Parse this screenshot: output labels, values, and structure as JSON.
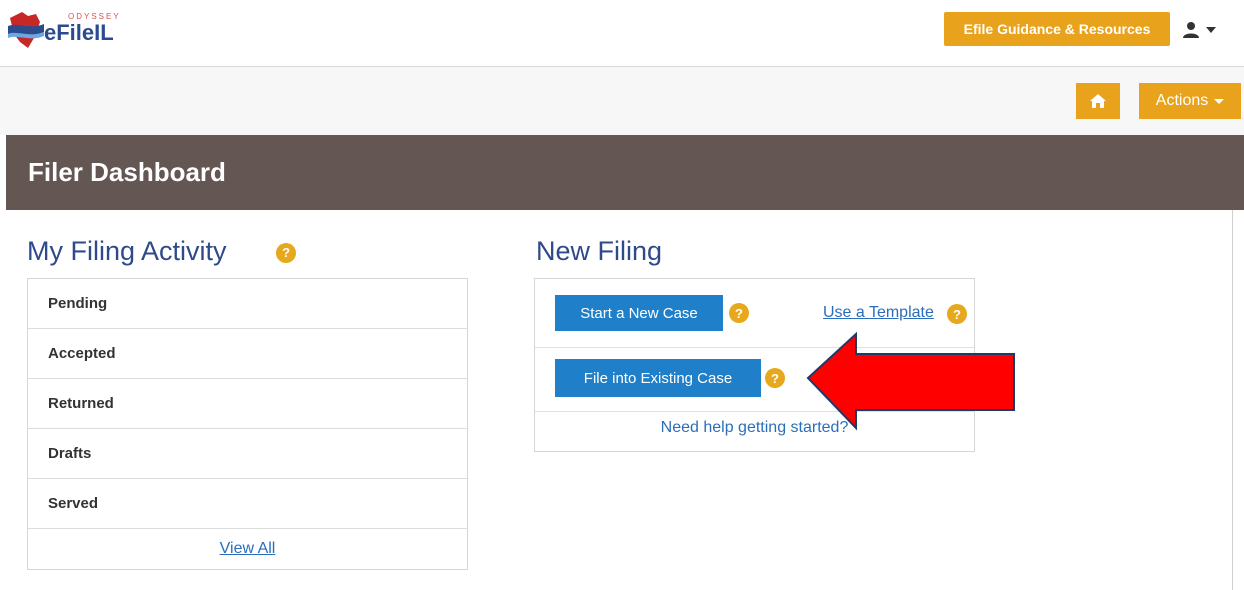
{
  "app": {
    "logo_small": "ODYSSEY",
    "logo_main": "eFileIL"
  },
  "topbar": {
    "guidance_label": "Efile Guidance & Resources"
  },
  "toolbar": {
    "actions_label": "Actions"
  },
  "page": {
    "title": "Filer Dashboard"
  },
  "activity": {
    "title": "My Filing Activity",
    "items": [
      "Pending",
      "Accepted",
      "Returned",
      "Drafts",
      "Served"
    ],
    "view_all": "View All"
  },
  "new_filing": {
    "title": "New Filing",
    "start_new_case": "Start a New Case",
    "use_template": "Use a Template",
    "file_existing": "File into Existing Case",
    "need_help": "Need help getting started?"
  },
  "colors": {
    "accent": "#e9a21b",
    "header_bg": "#635653",
    "primary_blue": "#1f7fc8",
    "arrow_red": "#ff0000"
  },
  "help_glyph": "?"
}
